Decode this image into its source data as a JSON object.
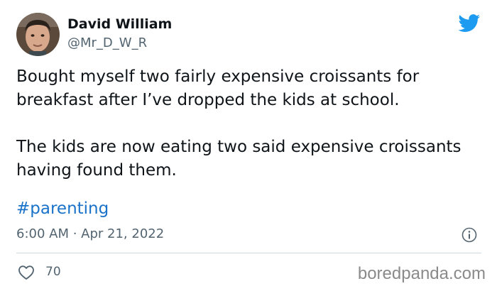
{
  "author": {
    "name": "David William",
    "handle": "@Mr_D_W_R",
    "avatar_icon": "profile-photo"
  },
  "platform_icon": "twitter-bird-icon",
  "tweet": {
    "paragraphs": [
      "Bought myself two fairly expensive croissants for breakfast after I’ve dropped the kids at school.",
      "The kids are now eating two said expensive croissants having found them."
    ],
    "hashtag": "#parenting",
    "timestamp": "6:00 AM · Apr 21, 2022"
  },
  "actions": {
    "likes": "70",
    "like_icon": "heart-icon",
    "info_icon": "info-icon"
  },
  "watermark": "boredpanda.com",
  "colors": {
    "link": "#1b73c9",
    "twitter_blue": "#1d9bf0",
    "secondary_text": "#536471",
    "divider": "#cfd9de"
  }
}
